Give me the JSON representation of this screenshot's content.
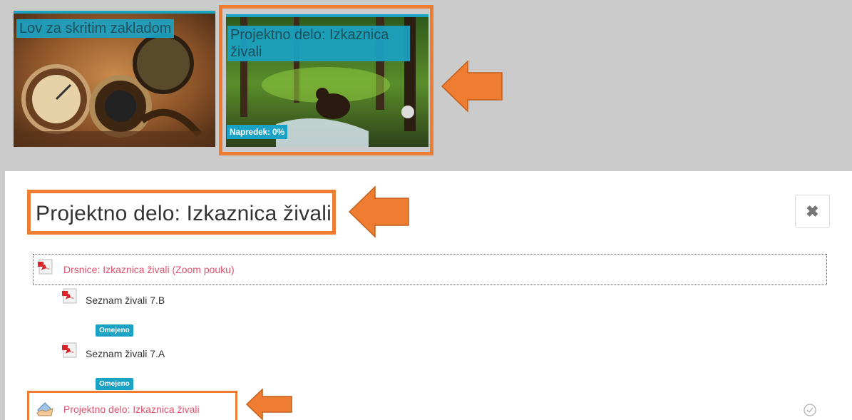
{
  "tiles": [
    {
      "title": "Lov za skritim zakladom"
    },
    {
      "title": "Projektno delo: Izkaznica živali",
      "progress": "Napredek: 0%"
    }
  ],
  "section": {
    "heading": "Projektno delo: Izkaznica živali",
    "close_symbol": "✖"
  },
  "activities": [
    {
      "label": "Drsnice: Izkaznica živali (Zoom pouku)",
      "icon": "pdf-icon"
    },
    {
      "label": "Seznam živali 7.B",
      "icon": "pdf-icon",
      "badge": "Omejeno"
    },
    {
      "label": "Seznam živali 7.A",
      "icon": "pdf-icon",
      "badge": "Omejeno"
    },
    {
      "label": "Projektno delo: Izkaznica živali",
      "icon": "assignment-icon"
    }
  ],
  "colors": {
    "accent": "#1aa3c4",
    "link": "#e0536e",
    "highlight": "#ee7d31",
    "band": "#cbcbcb"
  }
}
